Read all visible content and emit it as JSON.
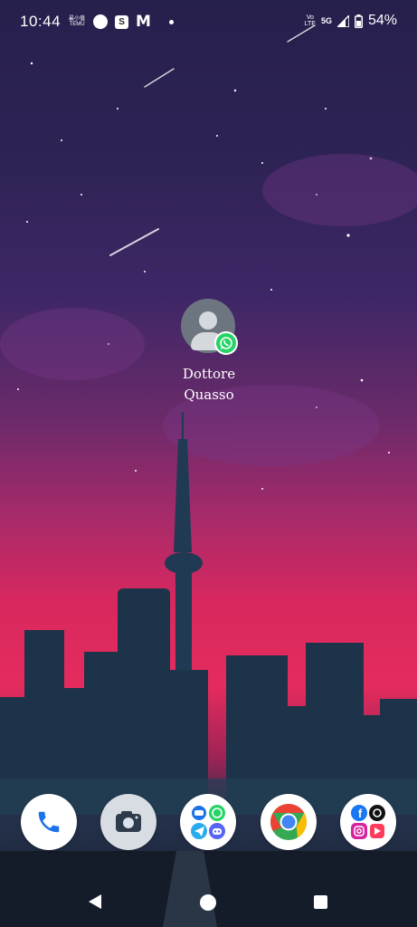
{
  "status_bar": {
    "time": "10:44",
    "mini_label_top": "最小值",
    "mini_label_bottom": "TEMU",
    "signal_label_top": "Vo",
    "signal_label_bottom": "LTE",
    "network_type": "5G",
    "battery_percent": "54%"
  },
  "home": {
    "shortcut": {
      "label_line1": "Dottore",
      "label_line2": "Quasso",
      "icon": "contact-avatar-icon",
      "badge_icon": "whatsapp-icon"
    }
  },
  "dock": {
    "items": [
      {
        "name": "phone",
        "icon": "phone-icon"
      },
      {
        "name": "camera",
        "icon": "camera-icon"
      },
      {
        "name": "messaging-folder",
        "icon": "folder-icon"
      },
      {
        "name": "chrome",
        "icon": "chrome-icon"
      },
      {
        "name": "social-folder",
        "icon": "folder-icon"
      }
    ]
  },
  "colors": {
    "whatsapp": "#25d366",
    "chrome_red": "#ea4335",
    "chrome_yellow": "#fbbc05",
    "chrome_green": "#34a853",
    "chrome_blue": "#4285f4",
    "facebook": "#1877f2",
    "telegram": "#2aabee",
    "discord": "#5865f2"
  }
}
